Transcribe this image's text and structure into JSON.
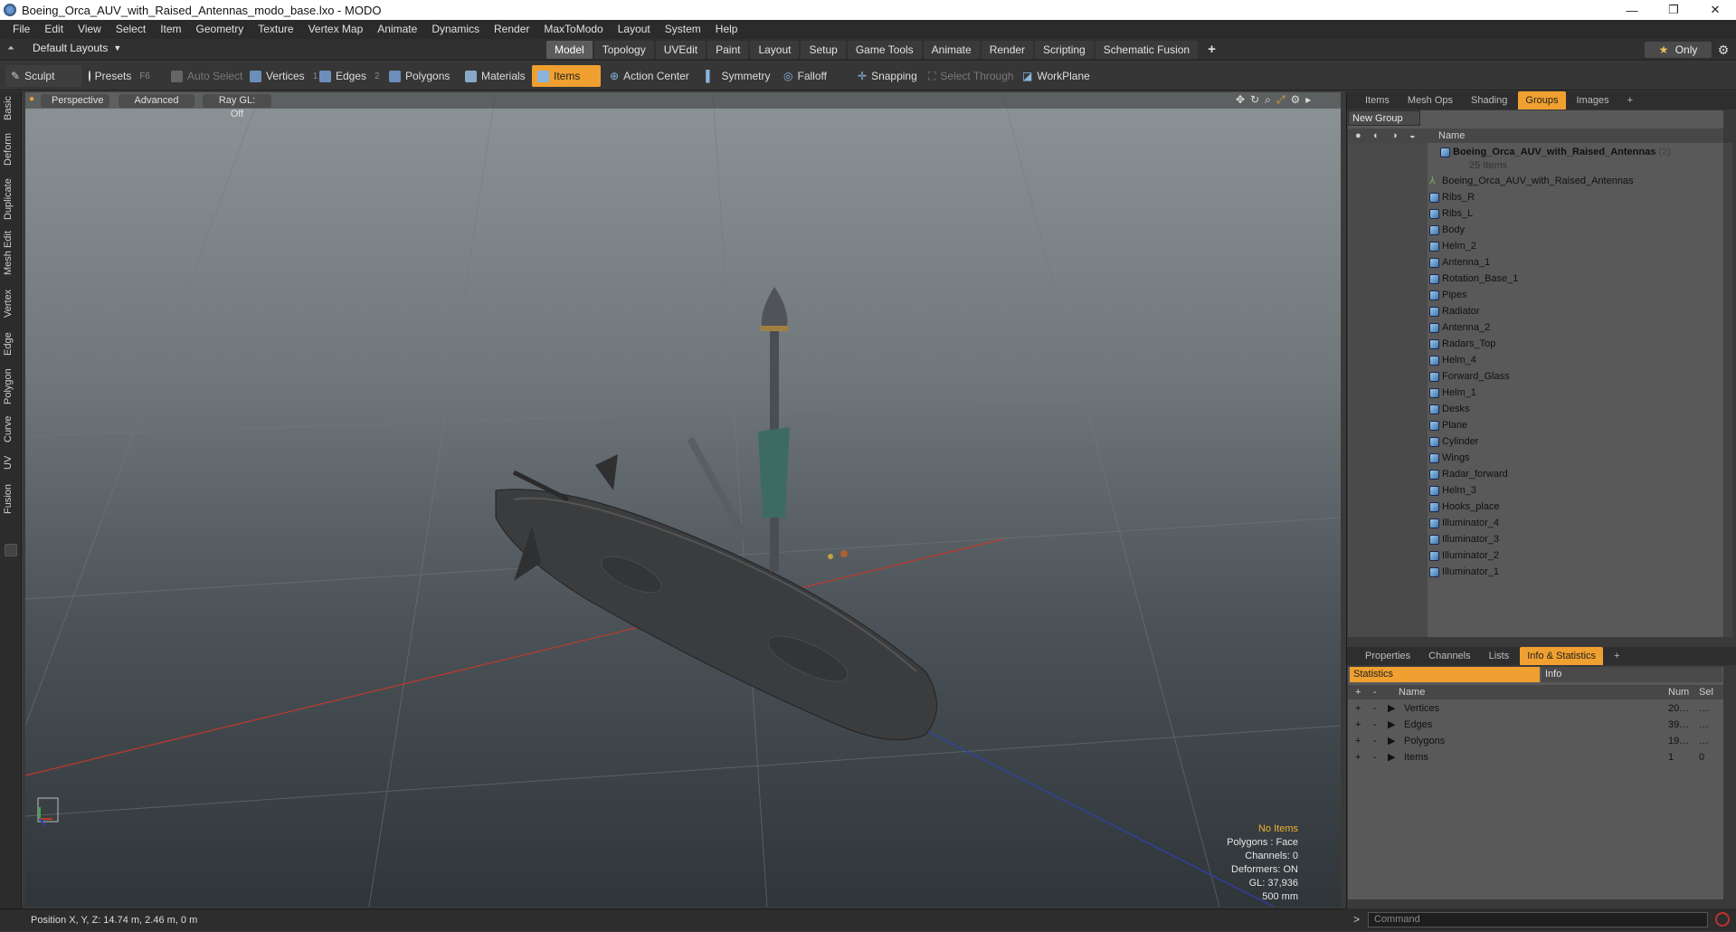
{
  "window": {
    "title": "Boeing_Orca_AUV_with_Raised_Antennas_modo_base.lxo - MODO",
    "controls": [
      "—",
      "❐",
      "✕"
    ]
  },
  "menu": [
    "File",
    "Edit",
    "View",
    "Select",
    "Item",
    "Geometry",
    "Texture",
    "Vertex Map",
    "Animate",
    "Dynamics",
    "Render",
    "MaxToModo",
    "Layout",
    "System",
    "Help"
  ],
  "layoutbar": {
    "layout_selector": "Default Layouts",
    "tabs": [
      "Model",
      "Topology",
      "UVEdit",
      "Paint",
      "Layout",
      "Setup",
      "Game Tools",
      "Animate",
      "Render",
      "Scripting",
      "Schematic Fusion"
    ],
    "active_tab": "Model",
    "add": "+",
    "only_label": "Only",
    "gear": "⚙"
  },
  "toolbar": {
    "sculpt": "Sculpt",
    "presets": "Presets",
    "presets_key": "F6",
    "auto_select": "Auto Select",
    "vertices": "Vertices",
    "vertices_num": "1",
    "edges": "Edges",
    "edges_num": "2",
    "polygons": "Polygons",
    "materials": "Materials",
    "items": "Items",
    "action_center": "Action Center",
    "symmetry": "Symmetry",
    "falloff": "Falloff",
    "snapping": "Snapping",
    "select_through": "Select Through",
    "workplane": "WorkPlane"
  },
  "left_tabs": [
    "Basic",
    "Deform",
    "Duplicate",
    "Mesh Edit",
    "Vertex",
    "Edge",
    "Polygon",
    "Curve",
    "UV",
    "Fusion"
  ],
  "viewport": {
    "view": "Perspective",
    "shading": "Advanced",
    "raygl": "Ray GL: Off",
    "info": {
      "selection": "No Items",
      "polygons": "Polygons : Face",
      "channels": "Channels: 0",
      "deformers": "Deformers: ON",
      "gl": "GL: 37,936",
      "scale": "500 mm"
    }
  },
  "status": {
    "position": "Position X, Y, Z:   14.74 m, 2.46 m, 0 m"
  },
  "groups_panel": {
    "tabs": [
      "Items",
      "Mesh Ops",
      "Shading",
      "Groups",
      "Images"
    ],
    "active_tab": "Groups",
    "new_group": "New Group",
    "name_header": "Name",
    "group_name": "Boeing_Orca_AUV_with_Raised_Antennas",
    "group_count": "(2) :",
    "group_items": "25 Items",
    "items": [
      "Boeing_Orca_AUV_with_Raised_Antennas",
      "Ribs_R",
      "Ribs_L",
      "Body",
      "Helm_2",
      "Antenna_1",
      "Rotation_Base_1",
      "Pipes",
      "Radiator",
      "Antenna_2",
      "Radars_Top",
      "Helm_4",
      "Forward_Glass",
      "Helm_1",
      "Desks",
      "Plane",
      "Cylinder",
      "Wings",
      "Radar_forward",
      "Helm_3",
      "Hooks_place",
      "Illuminator_4",
      "Illuminator_3",
      "Illuminator_2",
      "Illuminator_1"
    ]
  },
  "info_panel": {
    "tabs": [
      "Properties",
      "Channels",
      "Lists",
      "Info & Statistics"
    ],
    "active_tab": "Info & Statistics",
    "sub_tabs": [
      "Statistics",
      "Info"
    ],
    "headers": {
      "name": "Name",
      "num": "Num",
      "sel": "Sel"
    },
    "rows": [
      {
        "name": "Vertices",
        "num": "20…",
        "sel": "…"
      },
      {
        "name": "Edges",
        "num": "39…",
        "sel": "…"
      },
      {
        "name": "Polygons",
        "num": "19…",
        "sel": "…"
      },
      {
        "name": "Items",
        "num": "1",
        "sel": "0"
      }
    ]
  },
  "command": {
    "prompt": ">",
    "placeholder": "Command"
  },
  "colors": {
    "accent": "#f0a030",
    "x_axis": "#c0392b",
    "z_axis": "#3040b0"
  }
}
